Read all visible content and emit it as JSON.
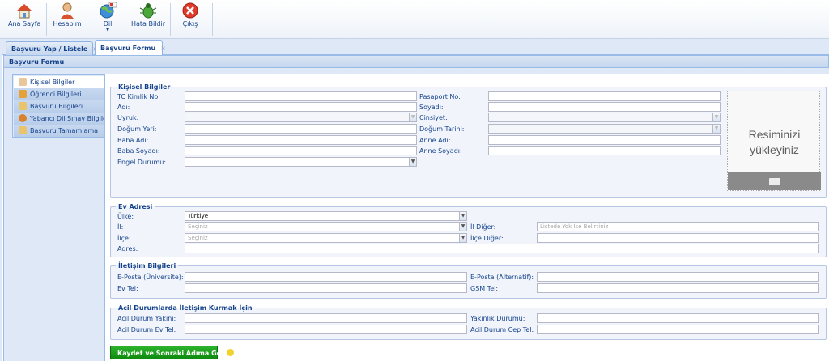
{
  "toolbar": {
    "home": "Ana Sayfa",
    "account": "Hesabım",
    "language": "Dil",
    "report_bug": "Hata Bildir",
    "logout": "Çıkış"
  },
  "tabs": [
    {
      "label": "Başvuru Yap / Listele",
      "close": "×"
    },
    {
      "label": "Başvuru Formu",
      "close": "×"
    }
  ],
  "panel_title": "Başvuru Formu",
  "nav": [
    {
      "label": "Kişisel Bilgiler",
      "icon": "person-icon"
    },
    {
      "label": "Öğrenci Bilgileri",
      "icon": "student-icon"
    },
    {
      "label": "Başvuru Bilgileri",
      "icon": "document-icon"
    },
    {
      "label": "Yabancı Dil Sınav Bilgileri",
      "icon": "globe-icon"
    },
    {
      "label": "Başvuru Tamamlama",
      "icon": "checklist-icon"
    }
  ],
  "personal": {
    "legend": "Kişisel Bilgiler",
    "tc": "TC Kimlik No:",
    "name": "Adı:",
    "nationality": "Uyruk:",
    "birthplace": "Doğum Yeri:",
    "father_name": "Baba Adı:",
    "father_surname": "Baba Soyadı:",
    "disability": "Engel Durumu:",
    "passport": "Pasaport No:",
    "surname": "Soyadı:",
    "gender": "Cinsiyet:",
    "birthdate": "Doğum Tarihi:",
    "mother_name": "Anne Adı:",
    "mother_surname": "Anne Soyadı:"
  },
  "photo": {
    "text_line1": "Resiminizi",
    "text_line2": "yükleyiniz"
  },
  "address": {
    "legend": "Ev Adresi",
    "country": "Ülke:",
    "country_value": "Türkiye",
    "city": "İl:",
    "city_placeholder": "Seçiniz",
    "district": "İlçe:",
    "district_placeholder": "Seçiniz",
    "addr": "Adres:",
    "city_other": "İl Diğer:",
    "city_other_placeholder": "Listede Yok İse Belirtiniz",
    "district_other": "İlçe Diğer:"
  },
  "contact": {
    "legend": "İletişim Bilgileri",
    "email_uni": "E-Posta (Üniversite):",
    "home_phone": "Ev Tel:",
    "email_alt": "E-Posta (Alternatif):",
    "gsm": "GSM Tel:"
  },
  "emergency": {
    "legend": "Acil Durumlarda İletişim Kurmak İçin",
    "relative": "Acil Durum Yakını:",
    "home_phone": "Acil Durum Ev Tel:",
    "closeness": "Yakınlık Durumu:",
    "mobile": "Acil Durum Cep Tel:"
  },
  "save_button": "Kaydet ve Sonraki Adıma Geç"
}
